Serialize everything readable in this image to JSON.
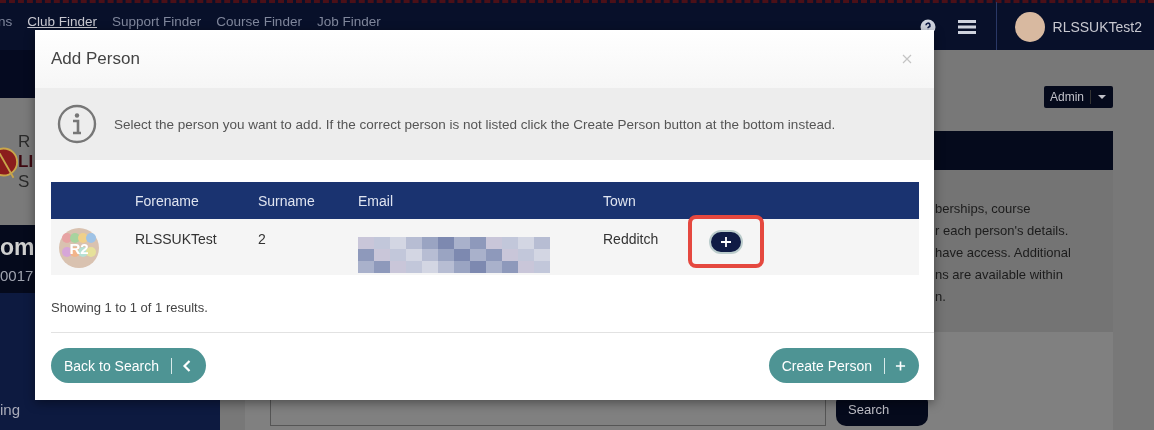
{
  "nav": {
    "items": [
      {
        "label": "ns",
        "selected": false
      },
      {
        "label": "Club Finder",
        "selected": true
      },
      {
        "label": "Support Finder",
        "selected": false
      },
      {
        "label": "Course Finder",
        "selected": false
      },
      {
        "label": "Job Finder",
        "selected": false
      }
    ],
    "user": "RLSSUKTest2"
  },
  "sidebar": {
    "logo_lines": [
      "R",
      "LI",
      "S"
    ],
    "title": "om",
    "number": "0017",
    "menu_item": "ing"
  },
  "page": {
    "admin_button": "Admin",
    "card_lines": [
      "berships, course",
      "r each person's details.",
      "have access. Additional",
      "ns are available within",
      "n."
    ],
    "search_button": "Search"
  },
  "modal": {
    "title": "Add Person",
    "info": "Select the person you want to add. If the correct person is not listed click the Create Person button at the bottom instead.",
    "columns": [
      "Forename",
      "Surname",
      "Email",
      "Town"
    ],
    "rows": [
      {
        "initials": "R2",
        "forename": "RLSSUKTest",
        "surname": "2",
        "email_redacted": true,
        "town": "Redditch",
        "highlighted": true
      }
    ],
    "summary": "Showing 1 to 1 of 1 results.",
    "back_button": "Back to Search",
    "create_button": "Create Person"
  }
}
